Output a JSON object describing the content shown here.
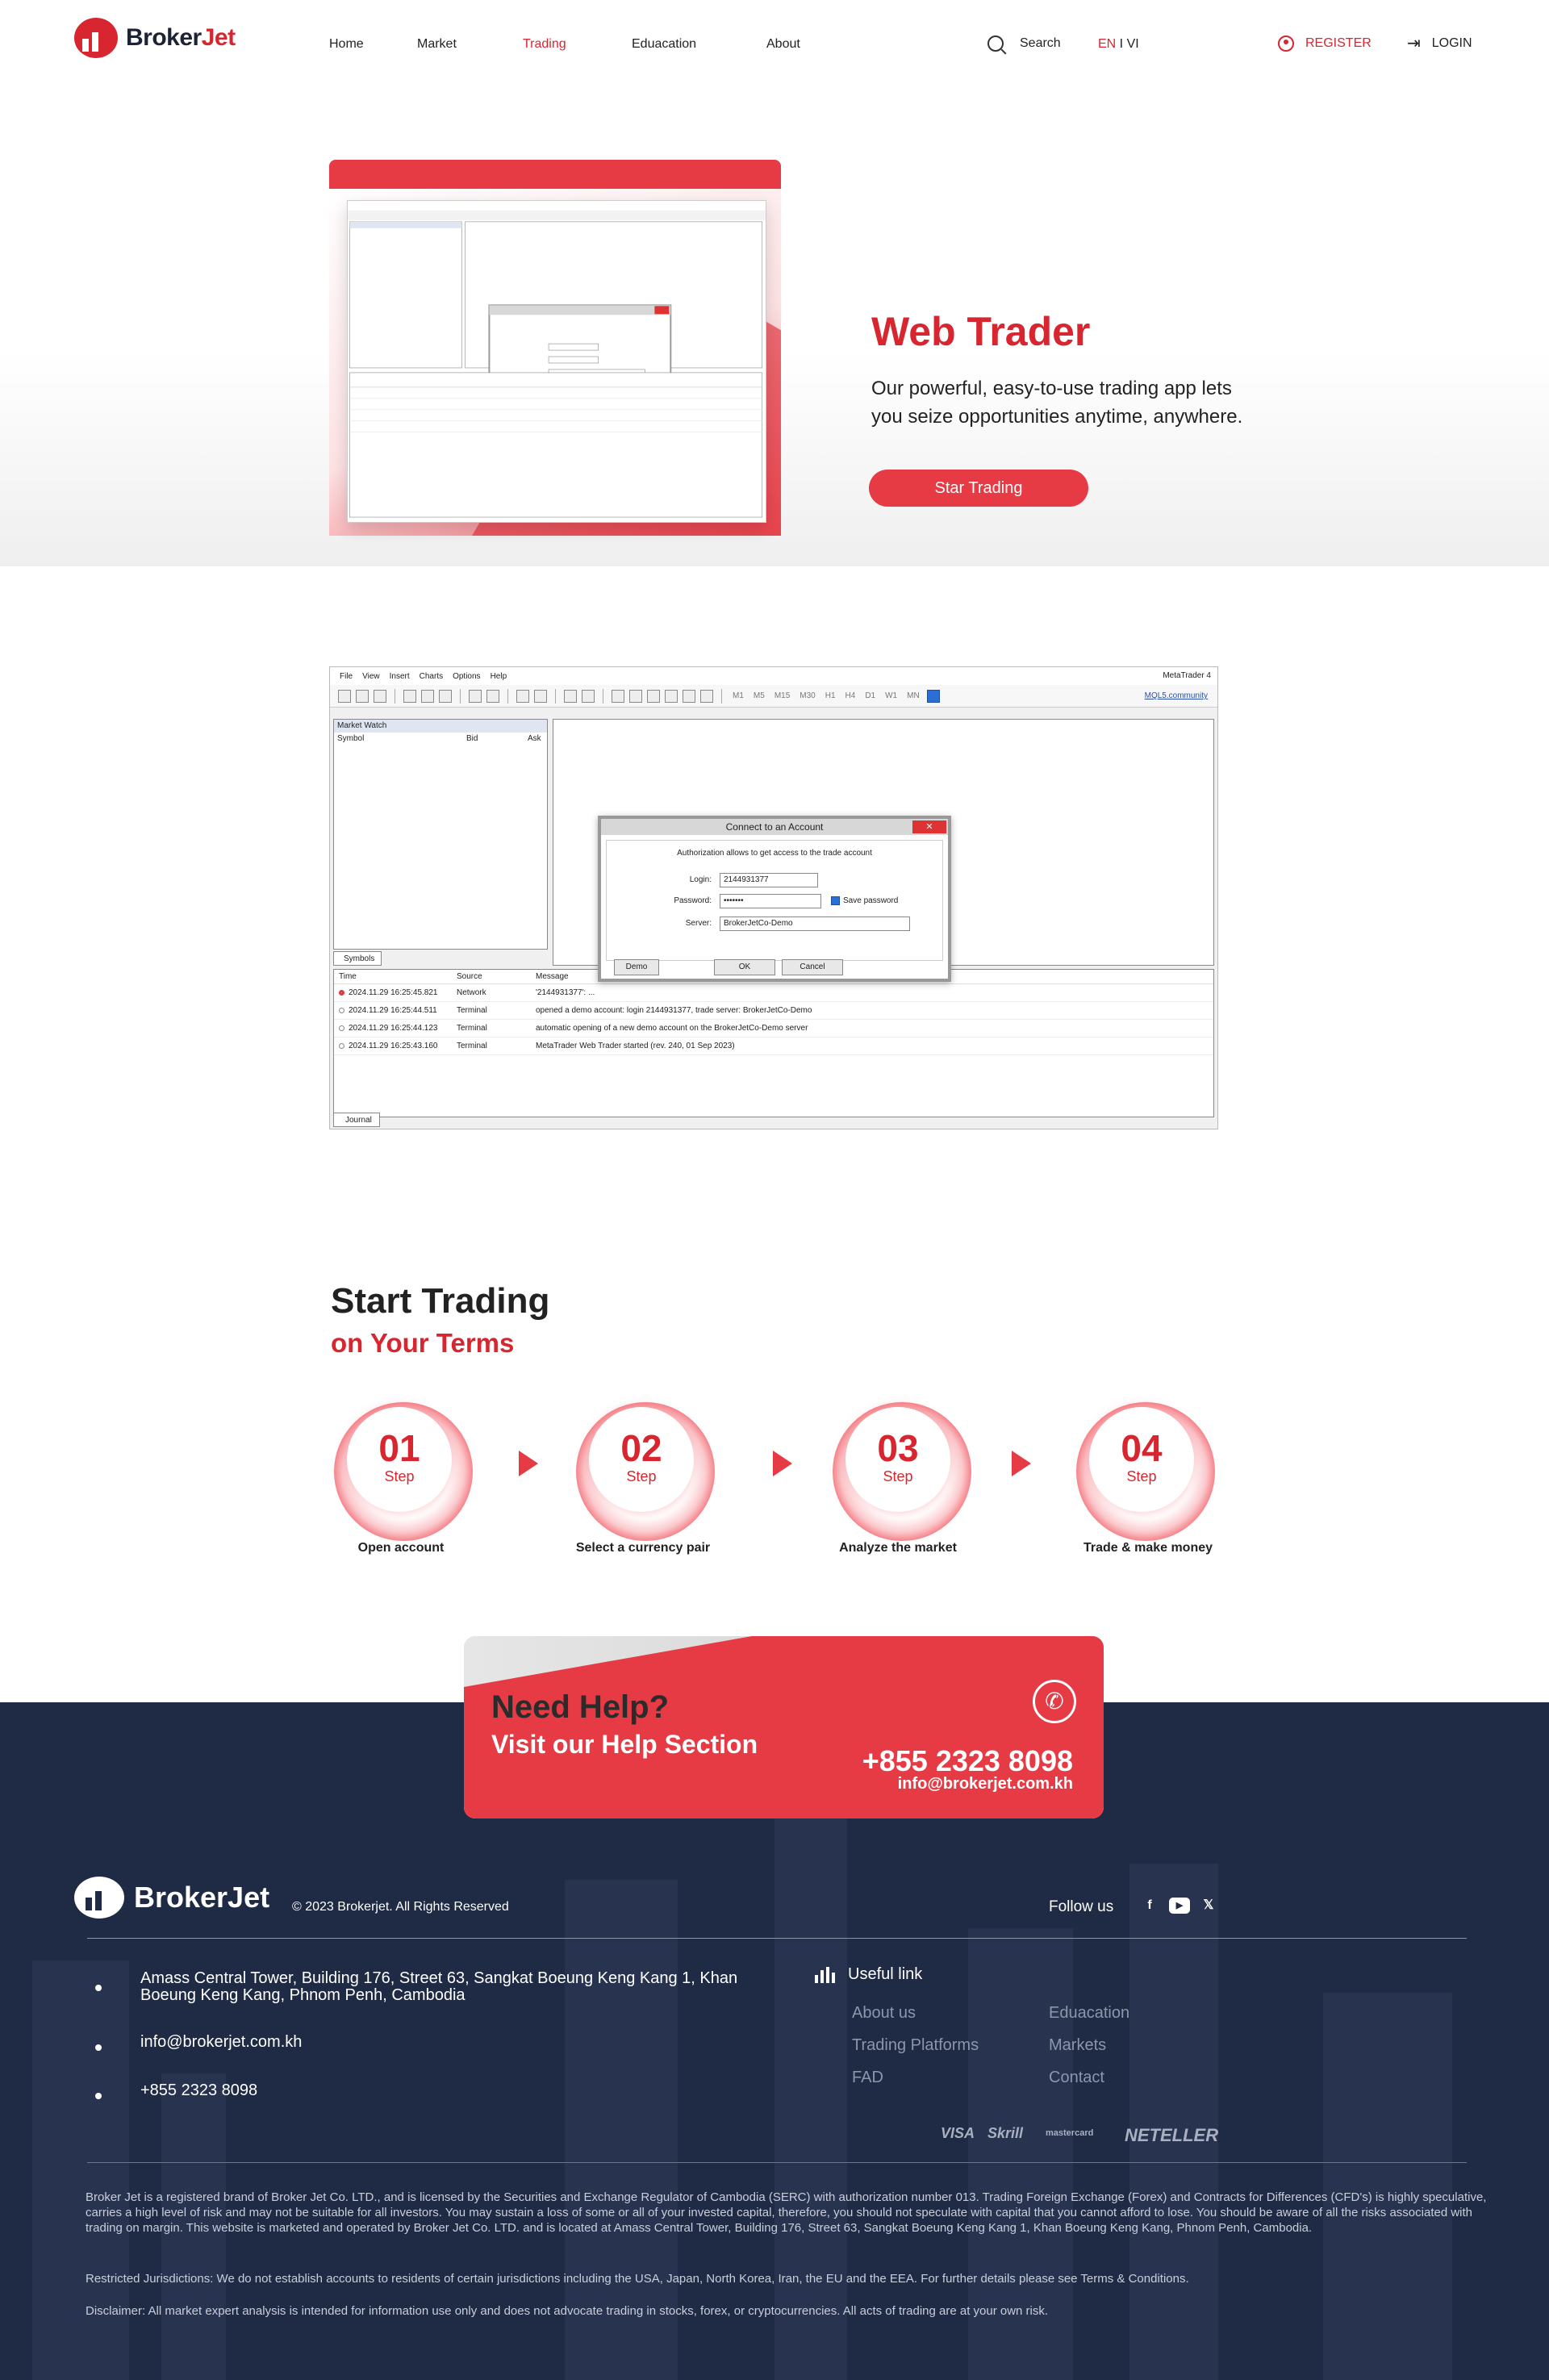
{
  "nav": {
    "logo_main": "Broker",
    "logo_accent": "Jet",
    "links": [
      "Home",
      "Market",
      "Trading",
      "Eduacation",
      "About"
    ],
    "active_link": "Trading",
    "search_label": "Search",
    "lang_en": "EN",
    "lang_sep": " I ",
    "lang_vi": "VI",
    "register": "REGISTER",
    "login": "LOGIN"
  },
  "hero": {
    "title": "Web Trader",
    "description": "Our powerful, easy-to-use trading app lets you seize opportunities anytime, anywhere.",
    "button": "Star Trading"
  },
  "mt4": {
    "menu": [
      "File",
      "View",
      "Insert",
      "Charts",
      "Options",
      "Help"
    ],
    "app_title": "MetaTrader 4",
    "timeframes": [
      "M1",
      "M5",
      "M15",
      "M30",
      "H1",
      "H4",
      "D1",
      "W1",
      "MN"
    ],
    "community_link": "MQL5.community",
    "market_watch": {
      "title": "Market Watch",
      "col_symbol": "Symbol",
      "col_bid": "Bid",
      "col_ask": "Ask",
      "tab": "Symbols"
    },
    "dialog": {
      "title": "Connect to an Account",
      "close": "✕",
      "note": "Authorization allows to get access to the trade account",
      "login_label": "Login:",
      "login_value": "2144931377",
      "password_label": "Password:",
      "password_value": "•••••••",
      "save_password": "Save password",
      "server_label": "Server:",
      "server_value": "BrokerJetCo-Demo",
      "demo_btn": "Demo",
      "ok_btn": "OK",
      "cancel_btn": "Cancel"
    },
    "journal": {
      "headers": [
        "Time",
        "Source",
        "Message"
      ],
      "rows": [
        {
          "time": "2024.11.29 16:25:45.821",
          "source": "Network",
          "message": "'2144931377': ...",
          "error": true
        },
        {
          "time": "2024.11.29 16:25:44.511",
          "source": "Terminal",
          "message": "opened a demo account: login 2144931377, trade server: BrokerJetCo-Demo",
          "error": false
        },
        {
          "time": "2024.11.29 16:25:44.123",
          "source": "Terminal",
          "message": "automatic opening of a new demo account on the BrokerJetCo-Demo server",
          "error": false
        },
        {
          "time": "2024.11.29 16:25:43.160",
          "source": "Terminal",
          "message": "MetaTrader Web Trader started (rev. 240, 01 Sep 2023)",
          "error": false
        }
      ],
      "tab": "Journal"
    }
  },
  "steps": {
    "title": "Start Trading",
    "subtitle": "on Your Terms",
    "step_word": "Step",
    "items": [
      {
        "num": "01",
        "label": "Open account"
      },
      {
        "num": "02",
        "label": "Select a currency pair"
      },
      {
        "num": "03",
        "label": "Analyze the market"
      },
      {
        "num": "04",
        "label": "Trade & make money"
      }
    ]
  },
  "help": {
    "title": "Need Help?",
    "subtitle": "Visit our Help Section",
    "phone": "+855 2323 8098",
    "email": "info@brokerjet.com.kh"
  },
  "footer": {
    "logo": "BrokerJet",
    "copyright": "© 2023 Brokerjet. All Rights Reserved",
    "follow": "Follow us",
    "social": [
      "facebook-icon",
      "youtube-icon",
      "twitter-icon"
    ],
    "address": "Amass Central Tower, Building 176, Street 63, Sangkat Boeung Keng Kang 1, Khan Boeung Keng Kang, Phnom Penh, Cambodia",
    "email": "info@brokerjet.com.kh",
    "phone": "+855 2323 8098",
    "useful_title": "Useful link",
    "links_col1": [
      "About us",
      "Trading Platforms",
      "FAD"
    ],
    "links_col2": [
      "Eduacation",
      "Markets",
      "Contact"
    ],
    "payments": [
      "VISA",
      "Skrill",
      "mastercard",
      "NETELLER"
    ],
    "legal1": "Broker Jet is a registered brand of Broker Jet Co. LTD., and is licensed by the Securities and Exchange Regulator of Cambodia (SERC) with authorization number 013. Trading Foreign Exchange (Forex) and Contracts for Differences (CFD's) is highly speculative, carries a high level of risk and may not be suitable for all investors. You may sustain a loss of some or all of your invested capital, therefore, you should not speculate with capital that you cannot afford to lose. You should be aware of all the risks associated with trading on margin. This website is marketed and operated by Broker Jet Co. LTD. and is located at Amass Central Tower, Building 176, Street 63, Sangkat Boeung Keng Kang 1, Khan Boeung Keng Kang, Phnom Penh, Cambodia.",
    "legal2": "Restricted Jurisdictions: We do not establish accounts to residents of certain jurisdictions including the USA, Japan, North Korea, Iran, the EU and the EEA. For further details please see Terms & Conditions.",
    "legal3": "Disclaimer: All market expert analysis is intended for information use only and does not advocate trading in stocks, forex, or cryptocurrencies. All acts of trading are at your own risk."
  },
  "colors": {
    "brand_red": "#d7262f",
    "footer_navy": "#1f2a44"
  }
}
